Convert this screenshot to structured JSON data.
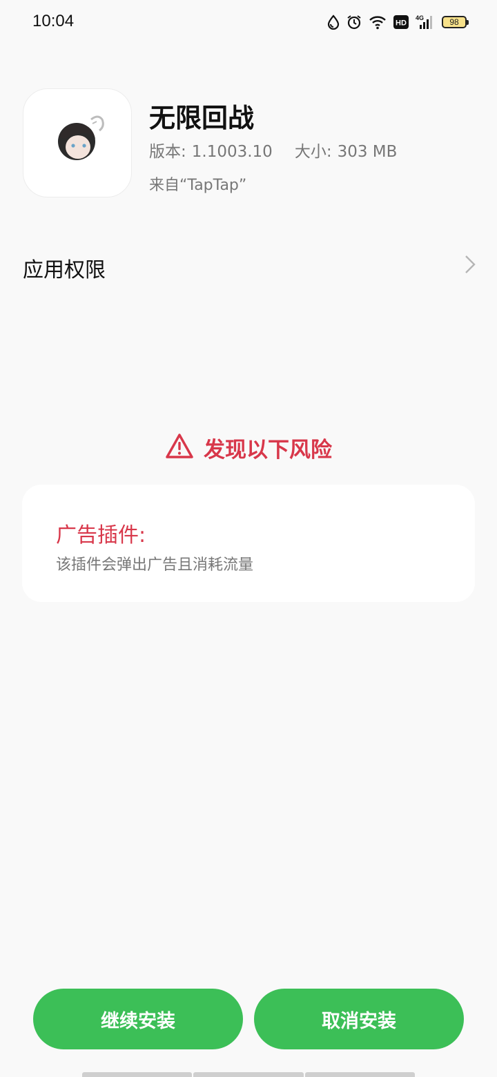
{
  "status_bar": {
    "time": "10:04",
    "battery": "98",
    "network": "4G",
    "hd": "HD",
    "icons": [
      "drop-icon",
      "alarm-icon",
      "wifi-icon",
      "hd-icon",
      "signal-4g-icon",
      "battery-icon"
    ]
  },
  "app": {
    "name": "无限回战",
    "version_label": "版本:",
    "version_value": "1.1003.10",
    "size_label": "大小:",
    "size_value": "303 MB",
    "source": "来自“TapTap”"
  },
  "permissions": {
    "label": "应用权限"
  },
  "risk": {
    "title": "发现以下风险",
    "items": [
      {
        "title": "广告插件:",
        "description": "该插件会弹出广告且消耗流量"
      }
    ]
  },
  "buttons": {
    "continue_label": "继续安装",
    "cancel_label": "取消安装"
  },
  "colors": {
    "accent_green": "#3cbf57",
    "risk_red": "#d8374a",
    "background": "#f9f9f9"
  }
}
